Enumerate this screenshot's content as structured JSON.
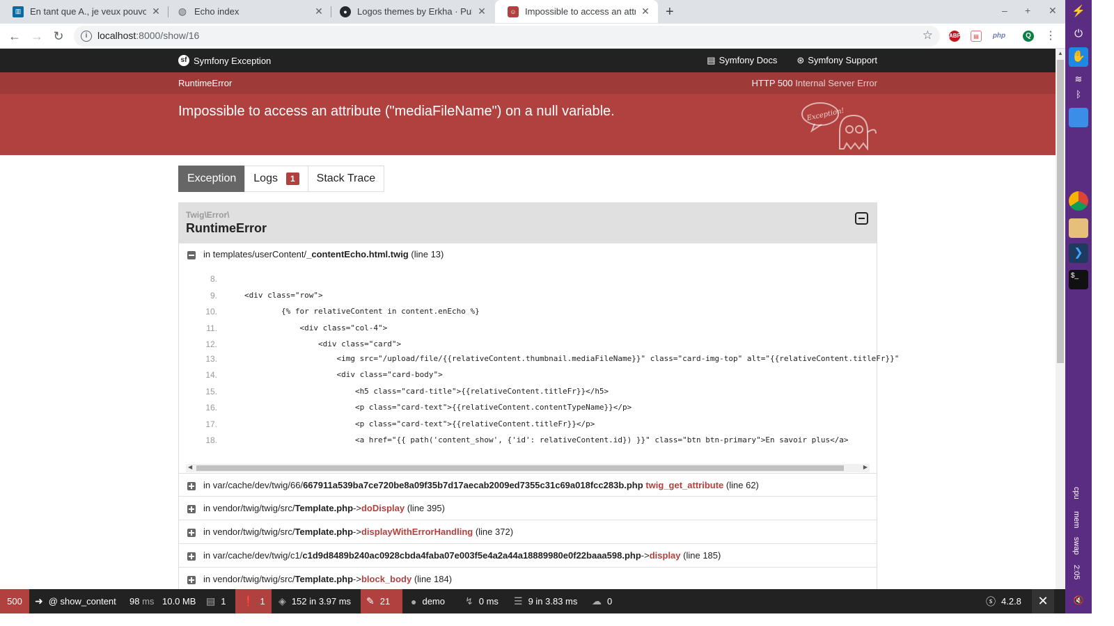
{
  "browser": {
    "tabs": [
      {
        "title": "En tant que A., je veux pouvoir l",
        "icon": "trello-icon"
      },
      {
        "title": "Echo index",
        "icon": "globe-icon"
      },
      {
        "title": "Logos themes by Erkha · Pull Re",
        "icon": "github-icon"
      },
      {
        "title": "Impossible to access an attribu",
        "icon": "symfony-error-icon",
        "active": true
      }
    ],
    "url_host": "localhost",
    "url_path": ":8000/show/16",
    "extensions": [
      "ABP",
      "php",
      "Q"
    ]
  },
  "symfony_header": {
    "brand": "Symfony Exception",
    "docs": "Symfony Docs",
    "support": "Symfony Support"
  },
  "summary": {
    "class": "RuntimeError",
    "status_code": "HTTP 500",
    "status_text": "Internal Server Error",
    "message": "Impossible to access an attribute (\"mediaFileName\") on a null variable.",
    "ghost_label": "Exception!"
  },
  "tabs": {
    "exception": "Exception",
    "logs": "Logs",
    "logs_count": "1",
    "stack_trace": "Stack Trace"
  },
  "trace": {
    "namespace": "Twig\\Error\\",
    "class": "RuntimeError",
    "first": {
      "prefix": "in templates/userContent/",
      "file": "_contentEcho.html.twig",
      "suffix": "(line 13)"
    },
    "code": [
      {
        "n": "8.",
        "c": ""
      },
      {
        "n": "9.",
        "c": "<div class=\"row\">"
      },
      {
        "n": "10.",
        "c": "        {% for relativeContent in content.enEcho %}"
      },
      {
        "n": "11.",
        "c": "            <div class=\"col-4\">"
      },
      {
        "n": "12.",
        "c": "                <div class=\"card\">"
      },
      {
        "n": "13.",
        "c": "                    <img src=\"/upload/file/{{relativeContent.thumbnail.mediaFileName}}\" class=\"card-img-top\" alt=\"{{relativeContent.titleFr}}\""
      },
      {
        "n": "14.",
        "c": "                    <div class=\"card-body\">"
      },
      {
        "n": "15.",
        "c": "                        <h5 class=\"card-title\">{{relativeContent.titleFr}}</h5>"
      },
      {
        "n": "16.",
        "c": "                        <p class=\"card-text\">{{relativeContent.contentTypeName}}</p>"
      },
      {
        "n": "17.",
        "c": "                        <p class=\"card-text\">{{relativeContent.titleFr}}</p>"
      },
      {
        "n": "18.",
        "c": "                        <a href=\"{{ path('content_show', {'id': relativeContent.id}) }}\" class=\"btn btn-primary\">En savoir plus</a>"
      }
    ],
    "frames": [
      {
        "prefix": "in var/cache/dev/twig/66/",
        "file": "667911a539ba7ce720be8a09f35b7d17aecab2009ed7355c31c69a018fcc283b.php",
        "arrow": "",
        "fn": "twig_get_attribute",
        "suffix": "(line 62)"
      },
      {
        "prefix": "in vendor/twig/twig/src/",
        "file": "Template.php",
        "arrow": "->",
        "fn": "doDisplay",
        "suffix": "(line 395)"
      },
      {
        "prefix": "in vendor/twig/twig/src/",
        "file": "Template.php",
        "arrow": "->",
        "fn": "displayWithErrorHandling",
        "suffix": "(line 372)"
      },
      {
        "prefix": "in var/cache/dev/twig/c1/",
        "file": "c1d9d8489b240ac0928cbda4faba07e003f5e4a2a44a18889980e0f22baaa598.php",
        "arrow": "->",
        "fn": "display",
        "suffix": "(line 185)"
      },
      {
        "prefix": "in vendor/twig/twig/src/",
        "file": "Template.php",
        "arrow": "->",
        "fn": "block_body",
        "suffix": "(line 184)"
      }
    ]
  },
  "toolbar": {
    "status": "500",
    "route": "@ show_content",
    "time": "98",
    "time_unit": "ms",
    "memory": "10.0 MB",
    "logs": "1",
    "errors": "1",
    "cache": "152 in 3.97 ms",
    "translation": "21",
    "user": "demo",
    "events": "0 ms",
    "db": "9 in 3.83 ms",
    "http": "0",
    "version": "4.2.8"
  },
  "os": {
    "cpu": "cpu",
    "mem": "mem",
    "swap": "swap",
    "clock": "2:05"
  }
}
